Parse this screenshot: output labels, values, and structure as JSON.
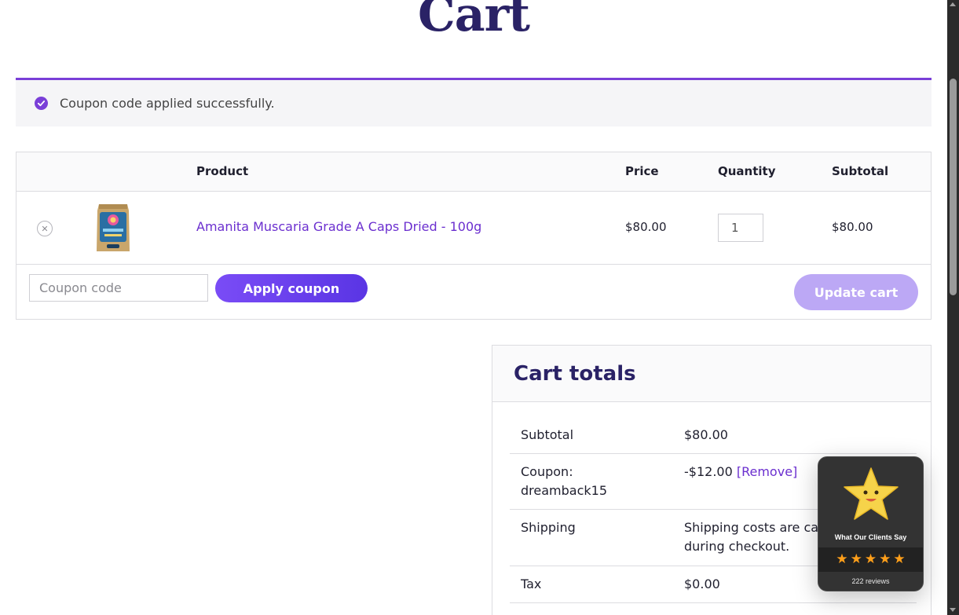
{
  "page": {
    "title": "Cart"
  },
  "notice": {
    "message": "Coupon code applied successfully."
  },
  "cart_table": {
    "headers": {
      "product": "Product",
      "price": "Price",
      "quantity": "Quantity",
      "subtotal": "Subtotal"
    },
    "items": [
      {
        "name": "Amanita Muscaria Grade A Caps Dried - 100g",
        "price": "$80.00",
        "quantity": "1",
        "subtotal": "$80.00"
      }
    ],
    "coupon_placeholder": "Coupon code",
    "apply_label": "Apply coupon",
    "update_label": "Update cart"
  },
  "totals": {
    "title": "Cart totals",
    "subtotal_label": "Subtotal",
    "subtotal_value": "$80.00",
    "coupon_label": "Coupon: dreamback15",
    "coupon_value": "-$12.00",
    "coupon_remove": "[Remove]",
    "shipping_label": "Shipping",
    "shipping_value": "Shipping costs are calculated during checkout.",
    "tax_label": "Tax",
    "tax_value": "$0.00"
  },
  "reviews_widget": {
    "caption": "What Our Clients Say",
    "rating_stars": 5,
    "count_text": "222 reviews"
  },
  "colors": {
    "brand_purple": "#7a3fd8",
    "title_navy": "#2a2266",
    "link_purple": "#6b2fcf",
    "star_orange": "#ff9f1a"
  }
}
